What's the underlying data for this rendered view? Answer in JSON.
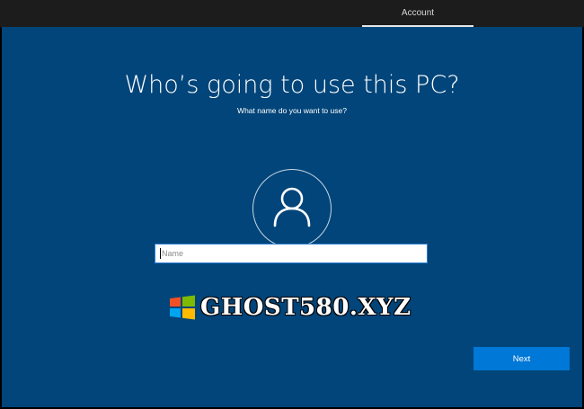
{
  "header": {
    "tab_label": "Account"
  },
  "main": {
    "title": "Who’s going to use this PC?",
    "subtitle": "What name do you want to use?",
    "avatar_icon": "user-icon",
    "name_input": {
      "placeholder": "Name",
      "value": ""
    },
    "next_label": "Next"
  },
  "watermark": {
    "text": "GHOST580.XYZ",
    "logo_icon": "windows-logo-icon"
  },
  "colors": {
    "background": "#01457a",
    "topbar": "#1c1c1c",
    "accent_button": "#0078d7",
    "input_border": "#2f7fd0"
  }
}
